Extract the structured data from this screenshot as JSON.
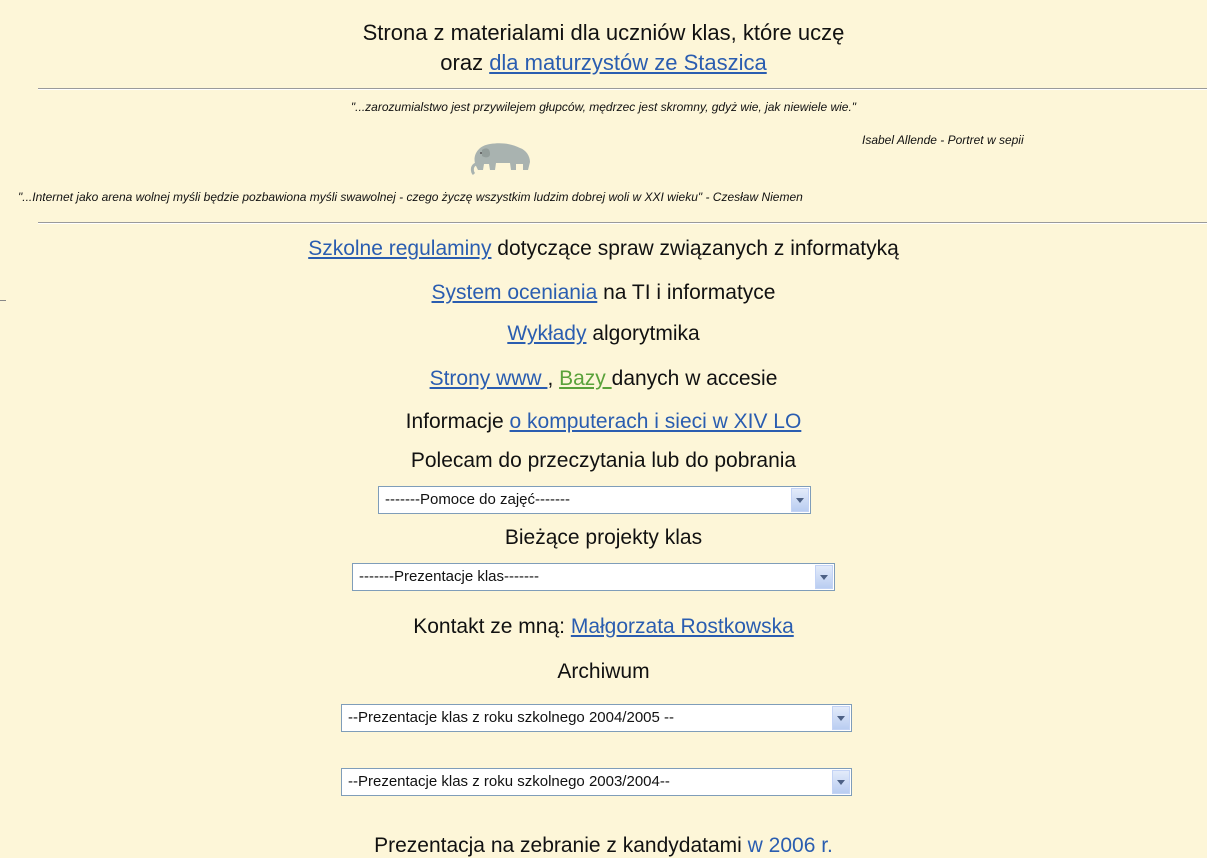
{
  "header": {
    "line1": "Strona z materialami dla uczniów klas, które uczę",
    "line2_prefix": "oraz ",
    "line2_link": "dla maturzystów ze Staszica"
  },
  "quotes": {
    "q1": "\"...zarozumialstwo jest przywilejem głupców, mędrzec jest skromny, gdyż wie, jak niewiele wie.\"",
    "q1_author": "Isabel Allende - Portret w sepii",
    "q2": "\"...Internet jako arena wolnej myśli będzie pozbawiona myśli swawolnej - czego życzę wszystkim ludzim dobrej woli w XXI wieku\" - Czesław Niemen"
  },
  "menu": {
    "regulaminy_link": "Szkolne regulaminy",
    "regulaminy_text": " dotyczące spraw związanych z informatyką",
    "ocenianie_link": "System oceniania",
    "ocenianie_text": " na TI i informatyce",
    "wyklady_link": "Wykłady",
    "wyklady_text": " algorytmika",
    "strony_link": "Strony www ",
    "strony_sep": ", ",
    "bazy_link": "Bazy ",
    "bazy_text": "danych w accesie",
    "informacje_text": "Informacje ",
    "informacje_link": "o komputerach i sieci w XIV LO",
    "polecam_text": "Polecam do przeczytania lub do pobrania",
    "projekty_text": "Bieżące projekty klas",
    "kontakt_text": "Kontakt ze mną: ",
    "kontakt_link": "Małgorzata Rostkowska",
    "archiwum_text": "Archiwum",
    "prezentacja_text": "Prezentacja na zebranie z kandydatami ",
    "prezentacja_link": "w 2006 r."
  },
  "selects": {
    "pomoce": "-------Pomoce do zajęć-------",
    "prezentacje": "-------Prezentacje klas-------",
    "arch_2004": "--Prezentacje klas z roku szkolnego 2004/2005 --",
    "arch_2003": "--Prezentacje klas z roku szkolnego 2003/2004--"
  },
  "colors": {
    "background": "#fdf6d8",
    "link": "#2a5db0",
    "bazy_link": "#5aa23a"
  }
}
